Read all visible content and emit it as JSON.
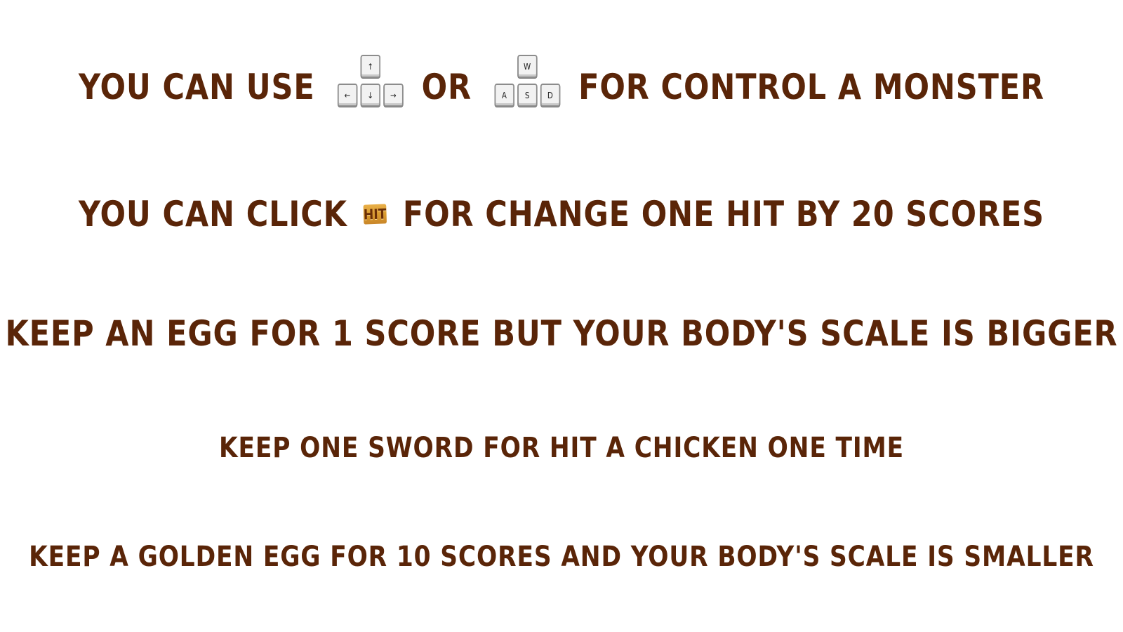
{
  "colors": {
    "text": "#5a2508",
    "background": "#ffffff",
    "hit_button": "#d99a2c"
  },
  "line1": {
    "before": "YOU CAN USE",
    "or": "OR",
    "after": "FOR CONTROL A MONSTER",
    "arrow_keys": {
      "up": "↑",
      "left": "←",
      "down": "↓",
      "right": "→"
    },
    "wasd_keys": {
      "w": "W",
      "a": "A",
      "s": "S",
      "d": "D"
    }
  },
  "line2": {
    "before": "YOU CAN CLICK",
    "hit_label": "HIT",
    "after": "FOR CHANGE ONE HIT BY 20 SCORES"
  },
  "line3": {
    "text": "KEEP AN EGG FOR 1 SCORE BUT YOUR BODY'S SCALE IS BIGGER"
  },
  "line4": {
    "text": "KEEP ONE SWORD FOR HIT A CHICKEN ONE TIME"
  },
  "line5": {
    "text": "KEEP A GOLDEN EGG FOR 10 SCORES AND YOUR BODY'S SCALE IS SMALLER"
  }
}
